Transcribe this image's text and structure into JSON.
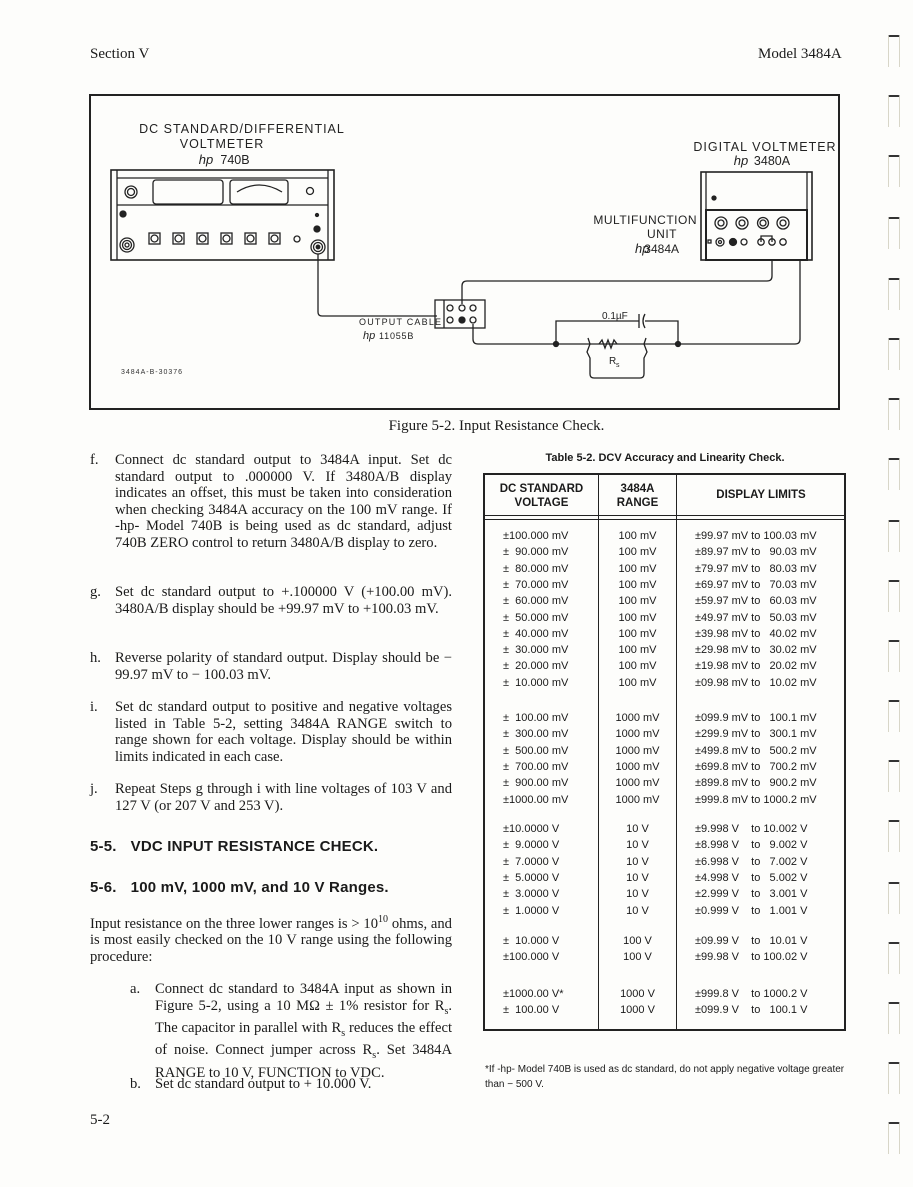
{
  "header": {
    "section": "Section V",
    "model": "Model 3484A"
  },
  "figure": {
    "dc_standard": {
      "line1": "DC STANDARD/DIFFERENTIAL",
      "line2": "VOLTMETER",
      "hp": "hp",
      "model": "740B"
    },
    "dvm": {
      "line1": "DIGITAL VOLTMETER",
      "hp": "hp",
      "model": "3480A"
    },
    "mfu": {
      "line1": "MULTIFUNCTION",
      "line2": "UNIT",
      "hp": "hp",
      "model": "3484A"
    },
    "cable": {
      "line1": "OUTPUT CABLE",
      "hp": "hp",
      "model": "11055B"
    },
    "capacitor": "0.1µF",
    "resistor": "R",
    "resistor_sub": "s",
    "drawing_number": "3484A-B-30376",
    "caption": "Figure 5-2.  Input Resistance Check."
  },
  "steps_top": [
    {
      "label": "f.",
      "text": "Connect dc standard output to 3484A input. Set dc standard output to .000000 V. If 3480A/B display indicates an offset, this must be taken into consideration when checking 3484A accuracy on the 100 mV range. If -hp- Model 740B is being used as dc standard, adjust 740B ZERO control to return 3480A/B display to zero."
    },
    {
      "label": "g.",
      "text": "Set dc standard output to +.100000 V (+100.00 mV). 3480A/B display should be +99.97 mV to +100.03 mV."
    },
    {
      "label": "h.",
      "text": "Reverse polarity of standard output. Display should be − 99.97 mV to − 100.03 mV."
    },
    {
      "label": "i.",
      "text": "Set dc standard output to positive and negative voltages listed in Table 5-2, setting 3484A RANGE switch to range shown for each voltage. Display should be within limits indicated in each case."
    },
    {
      "label": "j.",
      "text": "Repeat Steps g through i with line voltages of 103 V and 127 V (or 207 V and 253 V)."
    }
  ],
  "section_5_5": {
    "num": "5-5.",
    "title": "VDC INPUT RESISTANCE CHECK."
  },
  "section_5_6": {
    "num": "5-6.",
    "title": "100 mV, 1000 mV, and 10 V Ranges."
  },
  "intro": {
    "before": "Input resistance on the three lower ranges is > 10",
    "sup": "10",
    "after": " ohms, and is most easily checked on the 10 V range using the following procedure:"
  },
  "steps_bottom": {
    "a": {
      "label": "a.",
      "p1": "Connect dc standard to 3484A input as shown in Figure 5-2, using a 10 MΩ ± 1% resistor for R",
      "p2": ". The capacitor in parallel with R",
      "p3": " reduces the effect of noise. Connect jumper across R",
      "p4": ". Set 3484A RANGE to 10 V, FUNCTION to VDC.",
      "sub": "s"
    },
    "b": {
      "label": "b.",
      "text": "Set dc standard output to + 10.000 V."
    }
  },
  "page_number": "5-2",
  "table": {
    "title": "Table 5-2.  DCV Accuracy and Linearity Check.",
    "headers": [
      {
        "l1": "DC STANDARD",
        "l2": "VOLTAGE"
      },
      {
        "l1": "3484A",
        "l2": "RANGE"
      },
      {
        "l1": "DISPLAY LIMITS",
        "l2": ""
      }
    ],
    "groups": [
      {
        "rows": [
          [
            "±100.000 mV",
            "100 mV",
            "±99.97 mV to 100.03 mV"
          ],
          [
            "±  90.000 mV",
            "100 mV",
            "±89.97 mV to   90.03 mV"
          ],
          [
            "±  80.000 mV",
            "100 mV",
            "±79.97 mV to   80.03 mV"
          ],
          [
            "±  70.000 mV",
            "100 mV",
            "±69.97 mV to   70.03 mV"
          ],
          [
            "±  60.000 mV",
            "100 mV",
            "±59.97 mV to   60.03 mV"
          ],
          [
            "±  50.000 mV",
            "100 mV",
            "±49.97 mV to   50.03 mV"
          ],
          [
            "±  40.000 mV",
            "100 mV",
            "±39.98 mV to   40.02 mV"
          ],
          [
            "±  30.000 mV",
            "100 mV",
            "±29.98 mV to   30.02 mV"
          ],
          [
            "±  20.000 mV",
            "100 mV",
            "±19.98 mV to   20.02 mV"
          ],
          [
            "±  10.000 mV",
            "100 mV",
            "±09.98 mV to   10.02 mV"
          ]
        ]
      },
      {
        "rows": [
          [
            "±  100.00 mV",
            "1000 mV",
            "±099.9 mV to   100.1 mV"
          ],
          [
            "±  300.00 mV",
            "1000 mV",
            "±299.9 mV to   300.1 mV"
          ],
          [
            "±  500.00 mV",
            "1000 mV",
            "±499.8 mV to   500.2 mV"
          ],
          [
            "±  700.00 mV",
            "1000 mV",
            "±699.8 mV to   700.2 mV"
          ],
          [
            "±  900.00 mV",
            "1000 mV",
            "±899.8 mV to   900.2 mV"
          ],
          [
            "±1000.00 mV",
            "1000 mV",
            "±999.8 mV to 1000.2 mV"
          ]
        ]
      },
      {
        "rows": [
          [
            "±10.0000 V",
            "10 V",
            "±9.998 V    to 10.002 V"
          ],
          [
            "±  9.0000 V",
            "10 V",
            "±8.998 V    to   9.002 V"
          ],
          [
            "±  7.0000 V",
            "10 V",
            "±6.998 V    to   7.002 V"
          ],
          [
            "±  5.0000 V",
            "10 V",
            "±4.998 V    to   5.002 V"
          ],
          [
            "±  3.0000 V",
            "10 V",
            "±2.999 V    to   3.001 V"
          ],
          [
            "±  1.0000 V",
            "10 V",
            "±0.999 V    to   1.001 V"
          ]
        ]
      },
      {
        "rows": [
          [
            "±  10.000 V",
            "100 V",
            "±09.99 V    to   10.01 V"
          ],
          [
            "±100.000 V",
            "100 V",
            "±99.98 V    to 100.02 V"
          ]
        ]
      },
      {
        "rows": [
          [
            "±1000.00 V*",
            "1000 V",
            "±999.8 V    to 1000.2 V"
          ],
          [
            "±  100.00 V",
            "1000 V",
            "±099.9 V    to   100.1 V"
          ]
        ]
      }
    ],
    "footnote": "*If -hp- Model 740B is used as dc standard, do not apply negative voltage greater than − 500 V."
  }
}
